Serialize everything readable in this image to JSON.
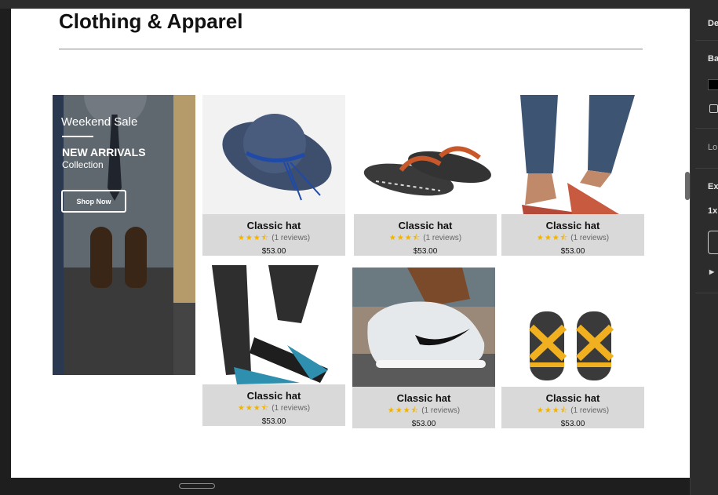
{
  "page": {
    "title": "Clothing & Apparel"
  },
  "banner": {
    "sale_text": "Weekend Sale",
    "headline": "NEW ARRIVALS",
    "subline": "Collection",
    "button_label": "Shop Now"
  },
  "products": [
    {
      "name": "Classic hat",
      "stars": "★★★⯪",
      "reviews": "(1 reviews)",
      "price": "$53.00"
    },
    {
      "name": "Classic hat",
      "stars": "★★★⯪",
      "reviews": "(1 reviews)",
      "price": "$53.00"
    },
    {
      "name": "Classic hat",
      "stars": "★★★⯪",
      "reviews": "(1 reviews)",
      "price": "$53.00"
    },
    {
      "name": "Classic hat",
      "stars": "★★★⯪",
      "reviews": "(1 reviews)",
      "price": "$53.00"
    },
    {
      "name": "Classic hat",
      "stars": "★★★⯪",
      "reviews": "(1 reviews)",
      "price": "$53.00"
    },
    {
      "name": "Classic hat",
      "stars": "★★★⯪",
      "reviews": "(1 reviews)",
      "price": "$53.00"
    }
  ],
  "panel": {
    "label_de": "De",
    "label_ba": "Ba",
    "label_lo": "Lo",
    "label_ex": "Ex",
    "label_1x": "1x"
  },
  "colors": {
    "accent_star": "#f2b300",
    "info_bg": "#d9d9d9",
    "editor_bg": "#2c2c2c"
  }
}
